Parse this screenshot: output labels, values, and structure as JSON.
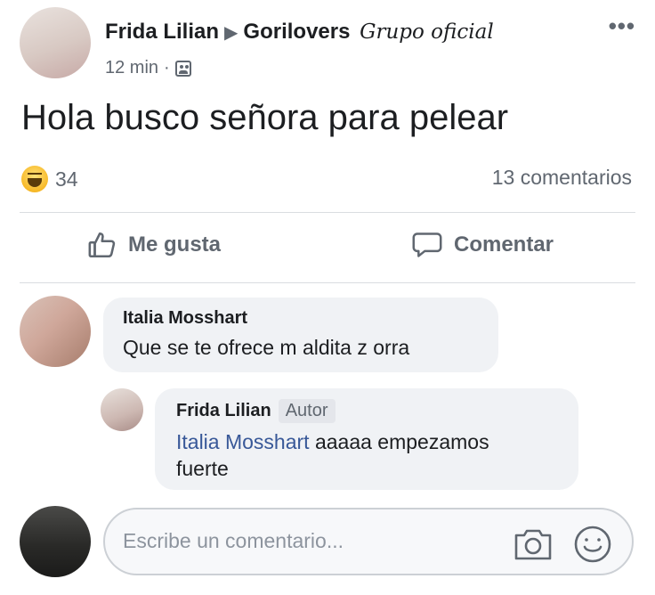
{
  "post": {
    "author": "Frida Lilian",
    "group": "Gorilovers",
    "group_tag": "Grupo oficial",
    "time": "12 min",
    "text": "Hola busco señora para pelear",
    "reactions_count": "34",
    "comments_count": "13 comentarios",
    "icons": {
      "options": "more-dots-icon",
      "audience": "group-icon",
      "reaction": "haha-reaction-icon"
    }
  },
  "actions": {
    "like_label": "Me gusta",
    "comment_label": "Comentar"
  },
  "comments": [
    {
      "name": "Italia Mosshart",
      "text": "Que se te ofrece m aldita z orra"
    }
  ],
  "reply": {
    "name": "Frida Lilian",
    "badge": "Autor",
    "mention": "Italia Mosshart",
    "text_line1": " aaaaa empezamos",
    "text_line2": "fuerte"
  },
  "composer": {
    "placeholder": "Escribe un comentario..."
  },
  "colors": {
    "text": "#1c1e21",
    "secondary": "#606770",
    "mention": "#385898",
    "bubble": "#f0f2f5"
  }
}
